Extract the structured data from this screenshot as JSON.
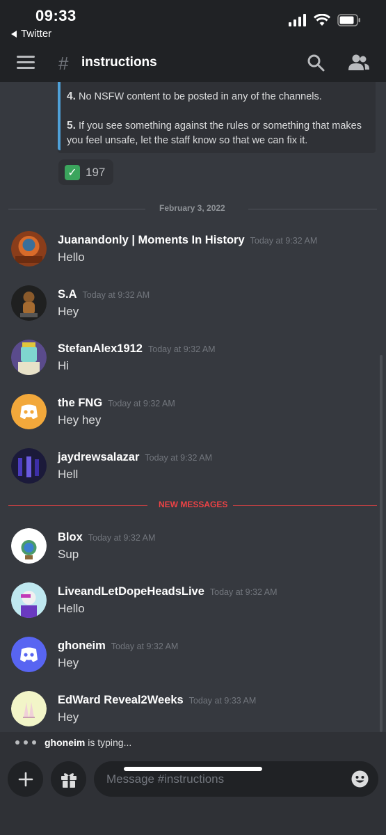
{
  "status_bar": {
    "time": "09:33",
    "back_app": "Twitter"
  },
  "header": {
    "channel": "instructions"
  },
  "rules": [
    {
      "number": "4.",
      "text": "No NSFW content to be posted in any of the channels."
    },
    {
      "number": "5.",
      "text": "If you see something against the rules or something that makes you feel unsafe, let the staff know so that we can fix it."
    }
  ],
  "reaction": {
    "emoji": "white-check-mark",
    "count": "197"
  },
  "date_divider": "February 3, 2022",
  "messages": [
    {
      "author": "Juanandonly | Moments In History",
      "time": "Today at 9:32 AM",
      "text": "Hello"
    },
    {
      "author": "S.A",
      "time": "Today at 9:32 AM",
      "text": "Hey"
    },
    {
      "author": "StefanAlex1912",
      "time": "Today at 9:32 AM",
      "text": "Hi"
    },
    {
      "author": "the FNG",
      "time": "Today at 9:32 AM",
      "text": "Hey hey"
    },
    {
      "author": "jaydrewsalazar",
      "time": "Today at 9:32 AM",
      "text": "Hell"
    },
    {
      "author": "Blox",
      "time": "Today at 9:32 AM",
      "text": "Sup"
    },
    {
      "author": "LiveandLetDopeHeadsLive",
      "time": "Today at 9:32 AM",
      "text": "Hello"
    },
    {
      "author": "ghoneim",
      "time": "Today at 9:32 AM",
      "text": "Hey"
    },
    {
      "author": "EdWard Reveal2Weeks",
      "time": "Today at 9:33 AM",
      "text": "Hey"
    }
  ],
  "new_messages_label": "NEW MESSAGES",
  "typing": {
    "user": "ghoneim",
    "suffix": "is typing..."
  },
  "composer": {
    "placeholder": "Message #instructions"
  },
  "colors": {
    "background": "#36393f",
    "header": "#202225",
    "accent_blue": "#4fa1d9",
    "new_messages_red": "#ed4245",
    "discord_blurple": "#5865f2",
    "discord_orange": "#f2a83b"
  }
}
